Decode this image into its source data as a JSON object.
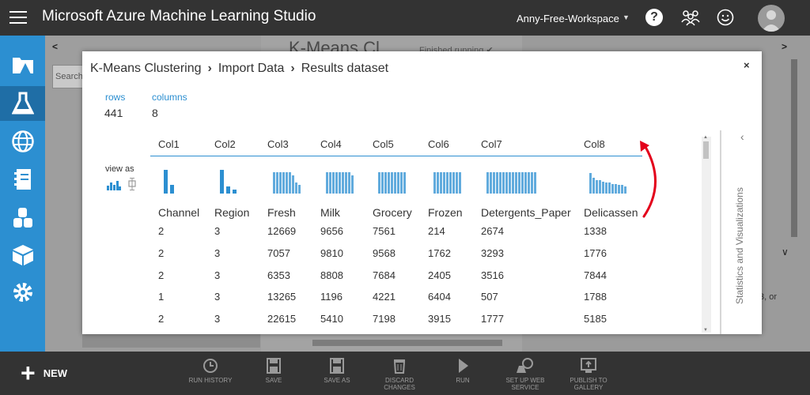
{
  "topbar": {
    "app_title": "Microsoft Azure Machine Learning Studio",
    "workspace": "Anny-Free-Workspace",
    "help_label": "?"
  },
  "background": {
    "canvas_title": "K-Means Cl",
    "run_status": "Finished running ✔",
    "search_placeholder": "Search",
    "or_text": "3, or"
  },
  "modal": {
    "breadcrumbs": [
      "K-Means Clustering",
      "Import Data",
      "Results dataset"
    ],
    "close_label": "×",
    "stats": {
      "rows_label": "rows",
      "rows_value": "441",
      "columns_label": "columns",
      "columns_value": "8"
    },
    "view_as_label": "view as",
    "columns": [
      {
        "header": "Col1",
        "name": "Channel"
      },
      {
        "header": "Col2",
        "name": "Region"
      },
      {
        "header": "Col3",
        "name": "Fresh"
      },
      {
        "header": "Col4",
        "name": "Milk"
      },
      {
        "header": "Col5",
        "name": "Grocery"
      },
      {
        "header": "Col6",
        "name": "Frozen"
      },
      {
        "header": "Col7",
        "name": "Detergents_Paper"
      },
      {
        "header": "Col8",
        "name": "Delicassen"
      }
    ],
    "rows": [
      [
        "2",
        "3",
        "12669",
        "9656",
        "7561",
        "214",
        "2674",
        "1338"
      ],
      [
        "2",
        "3",
        "7057",
        "9810",
        "9568",
        "1762",
        "3293",
        "1776"
      ],
      [
        "2",
        "3",
        "6353",
        "8808",
        "7684",
        "2405",
        "3516",
        "7844"
      ],
      [
        "1",
        "3",
        "13265",
        "1196",
        "4221",
        "6404",
        "507",
        "1788"
      ],
      [
        "2",
        "3",
        "22615",
        "5410",
        "7198",
        "3915",
        "1777",
        "5185"
      ]
    ],
    "side_panel_label": "Statistics and Visualizations"
  },
  "bottombar": {
    "new_label": "NEW",
    "commands": [
      {
        "label": "RUN HISTORY",
        "icon": "clock-icon"
      },
      {
        "label": "SAVE",
        "icon": "save-icon"
      },
      {
        "label": "SAVE AS",
        "icon": "save-as-icon"
      },
      {
        "label": "DISCARD CHANGES",
        "icon": "trash-icon"
      },
      {
        "label": "RUN",
        "icon": "play-icon"
      },
      {
        "label": "SET UP WEB SERVICE",
        "icon": "web-service-icon"
      },
      {
        "label": "PUBLISH TO GALLERY",
        "icon": "publish-icon"
      }
    ]
  },
  "colors": {
    "accent": "#2c8fd1",
    "topbar": "#333333",
    "rail": "#2c8fd1",
    "annotation": "#e3001b"
  }
}
